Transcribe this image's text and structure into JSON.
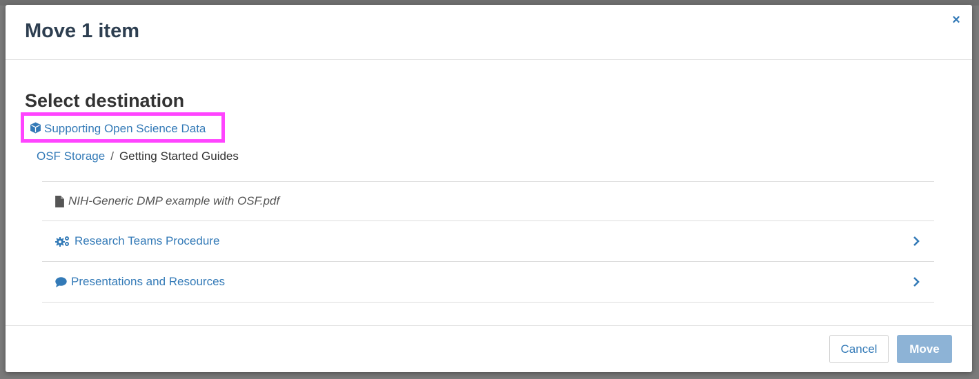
{
  "modal": {
    "title": "Move 1 item",
    "close_symbol": "×",
    "section_heading": "Select destination",
    "project": {
      "label": "Supporting Open Science Data",
      "icon": "cube-icon"
    },
    "breadcrumb": {
      "root": "OSF Storage",
      "separator": "/",
      "current": "Getting Started Guides"
    },
    "items": [
      {
        "label": "NIH-Generic DMP example with OSF.pdf",
        "type": "file",
        "icon": "file-icon"
      },
      {
        "label": "Research Teams Procedure",
        "type": "folder",
        "icon": "cogs-icon"
      },
      {
        "label": "Presentations and Resources",
        "type": "folder",
        "icon": "comment-icon"
      }
    ],
    "footer": {
      "cancel_label": "Cancel",
      "move_label": "Move"
    }
  },
  "colors": {
    "link": "#337ab7",
    "highlight_border": "#ff44ff",
    "move_button_disabled": "#8db3d6"
  }
}
